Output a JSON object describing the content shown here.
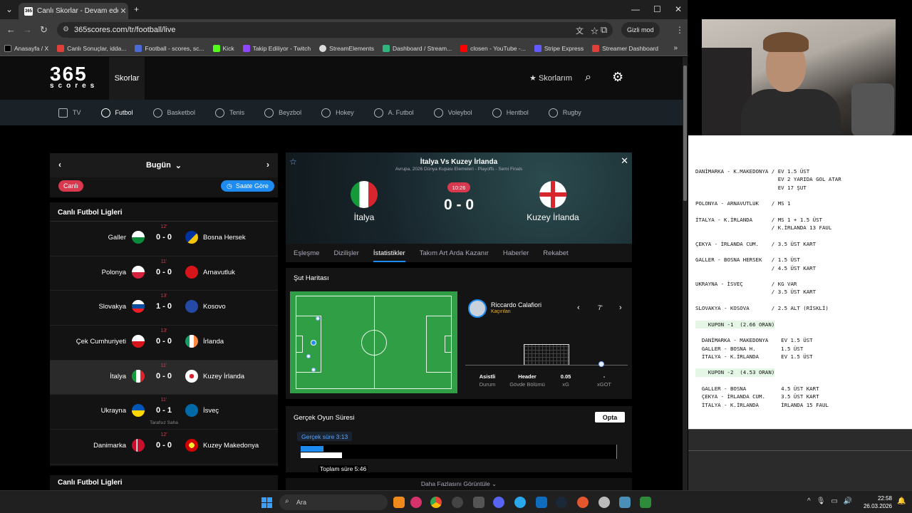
{
  "browser": {
    "tab_title": "Canlı Skorlar - Devam eden maç",
    "url": "365scores.com/tr/football/live",
    "incognito": "Gizli mod",
    "bookmarks": [
      "Anasayfa / X",
      "Canlı Sonuçlar, idda...",
      "Football - scores, sc...",
      "Kick",
      "Takip Ediliyor - Twitch",
      "StreamElements",
      "Dashboard / Stream...",
      "closen - YouTube -...",
      "Stripe Express",
      "Streamer Dashboard"
    ]
  },
  "site": {
    "logo_top": "365",
    "logo_bottom": "scores",
    "nav_active": "Skorlar",
    "my_scores": "Skorlarım"
  },
  "sports": [
    "TV",
    "Futbol",
    "Basketbol",
    "Tenis",
    "Beyzbol",
    "Hokey",
    "A. Futbol",
    "Voleybol",
    "Hentbol",
    "Rugby"
  ],
  "left": {
    "date_label": "Bugün",
    "live_btn": "Canlı",
    "time_btn": "Saate Göre",
    "leagues_title": "Canlı Futbol Ligleri",
    "leagues_title2": "Canlı Futbol Ligleri",
    "games": [
      {
        "minute": "12'",
        "home": "Galler",
        "score": "0 - 0",
        "away": "Bosna Hersek",
        "note": ""
      },
      {
        "minute": "11'",
        "home": "Polonya",
        "score": "0 - 0",
        "away": "Arnavutluk",
        "note": ""
      },
      {
        "minute": "13'",
        "home": "Slovakya",
        "score": "1 - 0",
        "away": "Kosovo",
        "note": ""
      },
      {
        "minute": "13'",
        "home": "Çek Cumhuriyeti",
        "score": "0 - 0",
        "away": "İrlanda",
        "note": ""
      },
      {
        "minute": "11'",
        "home": "İtalya",
        "score": "0 - 0",
        "away": "Kuzey İrlanda",
        "note": ""
      },
      {
        "minute": "11'",
        "home": "Ukrayna",
        "score": "0 - 1",
        "away": "İsveç",
        "note": "Tarafsız Saha"
      },
      {
        "minute": "12'",
        "home": "Danimarka",
        "score": "0 - 0",
        "away": "Kuzey Makedonya",
        "note": ""
      }
    ]
  },
  "match": {
    "title": "İtalya Vs Kuzey İrlanda",
    "subtitle": "Avrupa, 2026 Dünya Kupası Elemeleri - Playoffs - Semi Finals",
    "home": "İtalya",
    "away": "Kuzey İrlanda",
    "time": "10:26",
    "score": "0 - 0",
    "tabs": [
      "Eşleşme",
      "Dizilişler",
      "İstatistikler",
      "Takım Art Arda Kazanır",
      "Haberler",
      "Rekabet"
    ]
  },
  "shotmap": {
    "title": "Şut Haritası",
    "player": "Riccardo Calafiori",
    "result": "Kaçırılan",
    "minute": "7'",
    "stats": [
      {
        "v": "Asistli",
        "l": "Durum"
      },
      {
        "v": "Header",
        "l": "Gövde Bölümü"
      },
      {
        "v": "0.05",
        "l": "xG"
      },
      {
        "v": "-",
        "l": "xGOT"
      }
    ]
  },
  "realtime": {
    "title": "Gerçek Oyun Süresi",
    "provider": "Opta",
    "real_label": "Gerçek süre 3:13",
    "total_label": "Toplam süre 5:46",
    "real_fraction": 0.073,
    "total_fraction": 0.13
  },
  "more_label": "Daha Fazlasını Görüntüle ⌄",
  "notes": {
    "lines": [
      "DANİMARKA - K.MAKEDONYA / EV 1.5 ÜST",
      "                          EV 2 YARIDA GOL ATAR",
      "                          EV 17 ŞUT",
      "",
      "POLONYA - ARNAVUTLUK    / MS 1",
      "",
      "İTALYA - K.İRLANDA      / MS 1 + 1.5 ÜST",
      "                        / K.İRLANDA 13 FAUL",
      "",
      "ÇEKYA - İRLANDA CUM.    / 3.5 ÜST KART",
      "",
      "GALLER - BOSNA HERSEK   / 1.5 ÜST",
      "                        / 4.5 ÜST KART",
      "",
      "UKRAYNA - İSVEÇ         / KG VAR",
      "                        / 3.5 ÜST KART",
      "",
      "SLOVAKYA - KOSOVA       / 2.5 ALT (RİSKLİ)",
      "",
      "    KUPON -1  (2.66 ORAN)",
      "",
      "  DANİMARKA - MAKEDONYA    EV 1.5 ÜST",
      "  GALLER - BOSNA H.        1.5 ÜST",
      "  İTALYA - K.İRLANDA       EV 1.5 ÜST",
      "",
      "    KUPON -2  (4.53 ORAN)",
      "",
      "  GALLER - BOSNA           4.5 ÜST KART",
      "  ÇEKYA - İRLANDA CUM.     3.5 ÜST KART",
      "  İTALYA - K.İRLANDA       İRLANDA 15 FAUL"
    ]
  },
  "taskbar": {
    "search": "Ara",
    "time": "22:58",
    "date": "26.03.2026"
  }
}
